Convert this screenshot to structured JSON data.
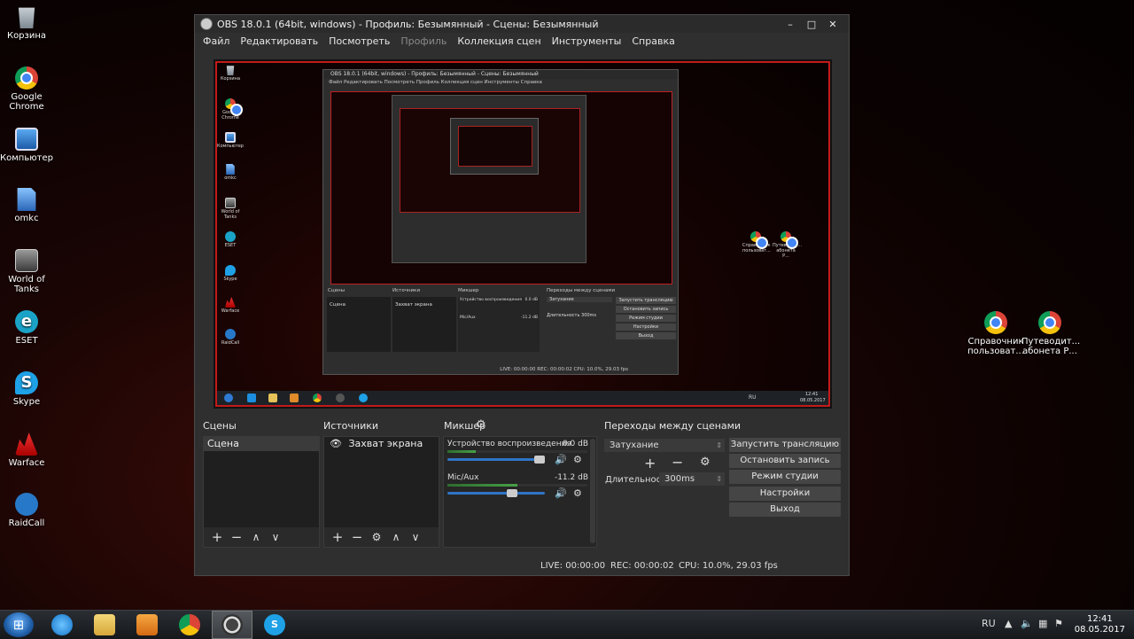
{
  "desktop": {
    "icons_left": [
      {
        "label": "Корзина",
        "icon": "recycle-bin-icon"
      },
      {
        "label": "Google Chrome",
        "icon": "chrome-icon"
      },
      {
        "label": "Компьютер",
        "icon": "computer-icon"
      },
      {
        "label": "omkc",
        "icon": "file-icon"
      },
      {
        "label": "World of Tanks",
        "icon": "world-of-tanks-icon"
      },
      {
        "label": "ESET",
        "icon": "eset-icon"
      },
      {
        "label": "Skype",
        "icon": "skype-icon"
      },
      {
        "label": "Warface",
        "icon": "warface-icon"
      },
      {
        "label": "RaidCall",
        "icon": "raidcall-icon"
      }
    ],
    "icons_right": [
      {
        "label": "Справочник пользоват...",
        "icon": "chrome-icon"
      },
      {
        "label": "Путеводит... абонета Р...",
        "icon": "chrome-icon"
      }
    ]
  },
  "window": {
    "title": "OBS 18.0.1 (64bit, windows) - Профиль: Безымянный - Сцены: Безымянный",
    "controls": {
      "minimize": "–",
      "maximize": "□",
      "close": "✕"
    }
  },
  "menu": [
    {
      "label": "Файл",
      "disabled": false
    },
    {
      "label": "Редактировать",
      "disabled": false
    },
    {
      "label": "Посмотреть",
      "disabled": false
    },
    {
      "label": "Профиль",
      "disabled": true
    },
    {
      "label": "Коллекция сцен",
      "disabled": false
    },
    {
      "label": "Инструменты",
      "disabled": false
    },
    {
      "label": "Справка",
      "disabled": false
    }
  ],
  "preview": {
    "mini_icons_left": [
      "Корзина",
      "Google Chrome",
      "Компьютер",
      "omkc",
      "World of Tanks",
      "ESET",
      "Skype",
      "Warface",
      "RaidCall"
    ],
    "mini_icons_right": [
      "Справочник пользоват...",
      "Путеводит... абонета Р..."
    ],
    "inner_title": "OBS 18.0.1 (64bit, windows) - Профиль: Безымянный - Сцены: Безымянный",
    "inner_menu": "Файл   Редактировать   Посмотреть   Профиль   Коллекция сцен   Инструменты   Справка",
    "inner_labels": {
      "scenes": "Сцены",
      "sources": "Источники",
      "mixer": "Микшер",
      "transitions": "Переходы между сценами"
    },
    "inner_scene": "Сцена",
    "inner_source": "Захват экрана",
    "inner_mixer": [
      {
        "name": "Устройство воспроизведения",
        "db": "0.0 dB"
      },
      {
        "name": "Mic/Aux",
        "db": "-11.2 dB"
      }
    ],
    "inner_transition": "Затухание",
    "inner_duration_label": "Длительность",
    "inner_duration": "300ms",
    "inner_buttons": [
      "Запустить трансляцию",
      "Остановить запись",
      "Режим студии",
      "Настройки",
      "Выход"
    ],
    "inner_status": "LIVE: 00:00:00     REC: 00:00:02     CPU: 10.0%, 29.03 fps",
    "mini_tray_lang": "RU",
    "mini_clock_time": "12:41",
    "mini_clock_date": "08.05.2017"
  },
  "scenes": {
    "label": "Сцены",
    "items": [
      "Сцена"
    ]
  },
  "sources": {
    "label": "Источники",
    "items": [
      "Захват экрана"
    ]
  },
  "mixer": {
    "label": "Микшер",
    "channels": [
      {
        "name": "Устройство воспроизведения",
        "db": "0.0 dB",
        "volume": 1.0,
        "meter": 0.2
      },
      {
        "name": "Mic/Aux",
        "db": "-11.2 dB",
        "volume": 0.68,
        "meter": 0.5
      }
    ]
  },
  "transitions": {
    "label": "Переходы между сценами",
    "selected": "Затухание",
    "duration_label": "Длительность",
    "duration_value": "300ms"
  },
  "controls": {
    "start_stream": "Запустить трансляцию",
    "stop_recording": "Остановить запись",
    "studio_mode": "Режим студии",
    "settings": "Настройки",
    "exit": "Выход"
  },
  "status": {
    "live": "LIVE: 00:00:00",
    "rec": "REC: 00:00:02",
    "cpu": "CPU: 10.0%, 29.03 fps"
  },
  "taskbar": {
    "apps": [
      "start-button",
      "internet-explorer-icon",
      "file-explorer-icon",
      "media-player-icon",
      "chrome-icon",
      "obs-icon",
      "skype-icon"
    ],
    "lang": "RU",
    "time": "12:41",
    "date": "08.05.2017"
  },
  "colors": {
    "accent": "#2f74c7",
    "preview_border": "#c21a1a",
    "window_bg": "#2f2f2f"
  }
}
